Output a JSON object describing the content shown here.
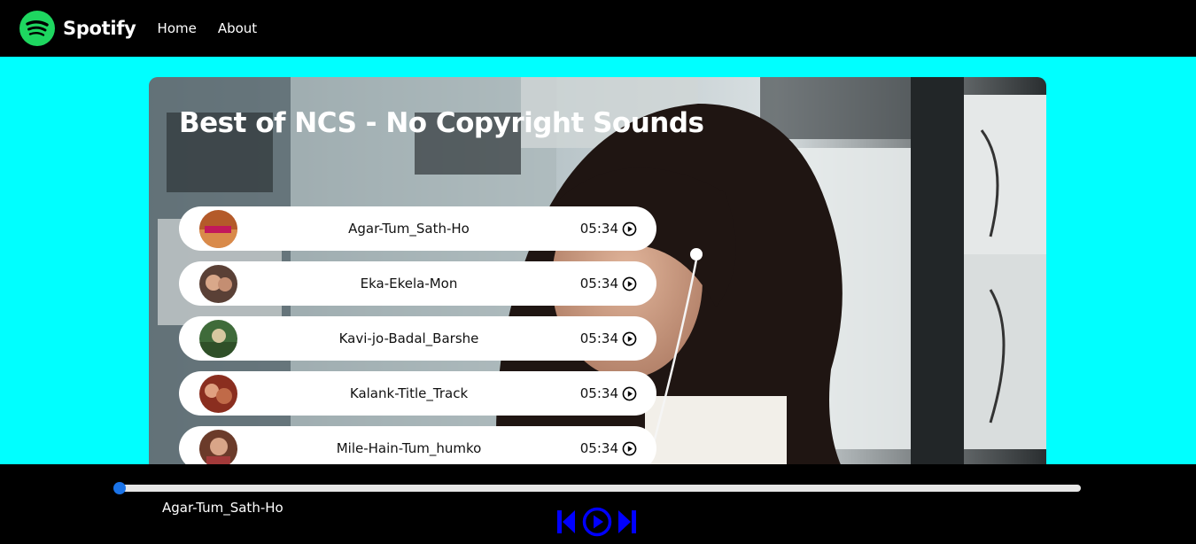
{
  "navbar": {
    "brand": "Spotify",
    "links": [
      "Home",
      "About"
    ]
  },
  "playlist": {
    "title": "Best of NCS - No Copyright Sounds",
    "songs": [
      {
        "name": "Agar-Tum_Sath-Ho",
        "duration": "05:34"
      },
      {
        "name": "Eka-Ekela-Mon",
        "duration": "05:34"
      },
      {
        "name": "Kavi-jo-Badal_Barshe",
        "duration": "05:34"
      },
      {
        "name": "Kalank-Title_Track",
        "duration": "05:34"
      },
      {
        "name": "Mile-Hain-Tum_humko",
        "duration": "05:34"
      }
    ]
  },
  "player": {
    "now_playing": "Agar-Tum_Sath-Ho",
    "progress": 0,
    "controls": [
      "previous-icon",
      "play-circle-icon",
      "next-icon"
    ]
  },
  "colors": {
    "page_bg": "#00ffff",
    "bars": "#000000",
    "brand_green": "#1ed760",
    "progress_accent": "#1a73e8",
    "control_blue": "#0000ff"
  }
}
